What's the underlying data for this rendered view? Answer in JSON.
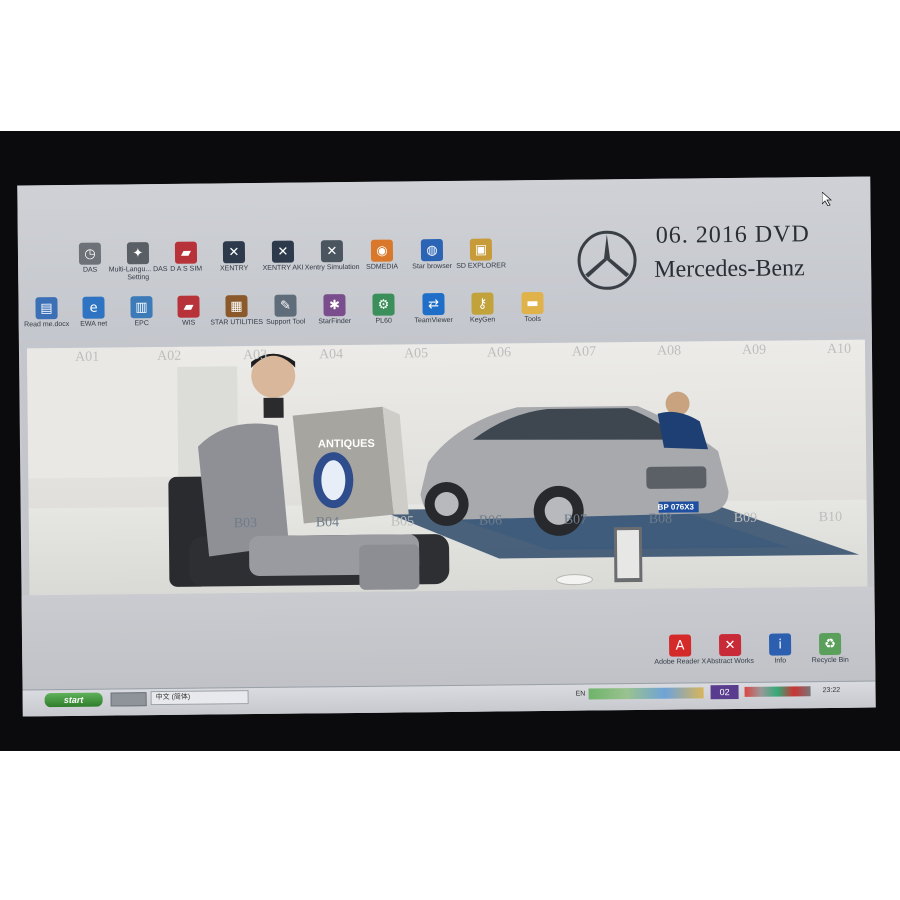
{
  "brand": {
    "title": "06. 2016 DVD",
    "name": "Mercedes-Benz"
  },
  "desktop_icons_row1": [
    {
      "label": "DAS",
      "icon": "clock-icon",
      "color": "#6d7278"
    },
    {
      "label": "Multi-Langu... DAS Setting",
      "icon": "star-icon",
      "color": "#5a5f66"
    },
    {
      "label": "D A S SIM",
      "icon": "car-icon",
      "color": "#b8323a"
    },
    {
      "label": "XENTRY",
      "icon": "tools-icon",
      "color": "#2c3a4c"
    },
    {
      "label": "XENTRY AKI",
      "icon": "tools-icon",
      "color": "#2c3a4c"
    },
    {
      "label": "Xentry Simulation",
      "icon": "tools-icon",
      "color": "#4b5560"
    },
    {
      "label": "SDMEDIA",
      "icon": "media-icon",
      "color": "#d9782a"
    },
    {
      "label": "Star browser",
      "icon": "globe-icon",
      "color": "#2b63b5"
    },
    {
      "label": "SD EXPLORER",
      "icon": "explorer-icon",
      "color": "#c79b3a"
    }
  ],
  "desktop_icons_row2": [
    {
      "label": "Read me.docx",
      "icon": "document-icon",
      "color": "#3b6fb6"
    },
    {
      "label": "EWA net",
      "icon": "browser-icon",
      "color": "#2f74c2"
    },
    {
      "label": "EPC",
      "icon": "book-icon",
      "color": "#3c7ab8"
    },
    {
      "label": "WIS",
      "icon": "car-icon",
      "color": "#b8323a"
    },
    {
      "label": "STAR UTILITIES",
      "icon": "cube-icon",
      "color": "#8a5a2c"
    },
    {
      "label": "Support Tool",
      "icon": "support-icon",
      "color": "#5f6d7b"
    },
    {
      "label": "StarFinder",
      "icon": "finder-icon",
      "color": "#7a4e8d"
    },
    {
      "label": "PL60",
      "icon": "gear-icon",
      "color": "#3a8f5a"
    },
    {
      "label": "TeamViewer",
      "icon": "teamviewer-icon",
      "color": "#1f6fc9"
    },
    {
      "label": "KeyGen",
      "icon": "key-icon",
      "color": "#c2a23a"
    },
    {
      "label": "Tools",
      "icon": "folder-icon",
      "color": "#e0b24a"
    }
  ],
  "grid_top": [
    "A01",
    "A02",
    "A03",
    "A04",
    "A05",
    "A06",
    "A07",
    "A08",
    "A09",
    "A10"
  ],
  "grid_bottom": [
    "B03",
    "B04",
    "B05",
    "B06",
    "B07",
    "B08",
    "B09",
    "B10"
  ],
  "magazine": {
    "title": "ANTIQUES"
  },
  "plate": "BP 076X3",
  "desktop_icons_bottom": [
    {
      "label": "Adobe Reader X",
      "icon": "pdf-icon",
      "color": "#d42a2a"
    },
    {
      "label": "Abstract Works",
      "icon": "abstract-icon",
      "color": "#c92a37"
    },
    {
      "label": "Info",
      "icon": "info-icon",
      "color": "#2c5fb0"
    },
    {
      "label": "Recycle Bin",
      "icon": "recycle-icon",
      "color": "#5aa05a"
    }
  ],
  "taskbar": {
    "start_label": "start",
    "language_bar": "中文 (简体)",
    "lang": "EN",
    "badge": "02",
    "clock": "23:22"
  }
}
